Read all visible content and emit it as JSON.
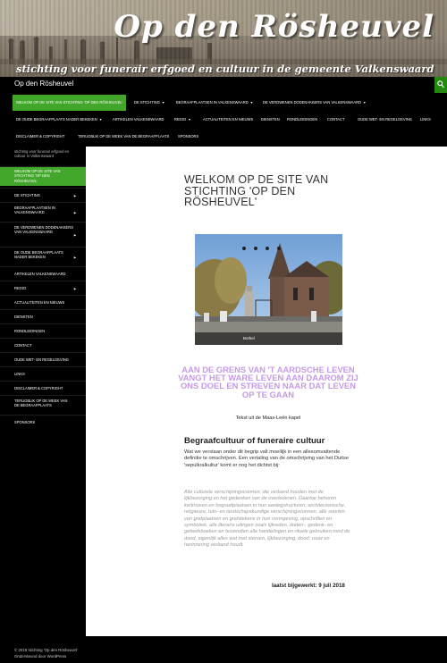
{
  "banner": {
    "title": "Op den Rösheuvel",
    "tagline": "stichting voor funerair erfgoed en cultuur in de gemeente Valkenswaard"
  },
  "topbar": {
    "site_title": "Op den Rösheuvel"
  },
  "nav": {
    "row1": [
      {
        "label": "Welkom op de site van Stichting 'Op den Rösheuvel'",
        "active": true
      },
      {
        "label": "De Stichting",
        "caret": true
      },
      {
        "label": "Begraafplaatsen in Valkenswaard",
        "caret": true
      },
      {
        "label": "De verdwenen dodenakkers van Valkenswaard",
        "caret": true
      }
    ],
    "row2": [
      {
        "label": "De oude begraafplaats nader bekeken",
        "caret": true
      },
      {
        "label": "Artikelen Valkenswaard"
      },
      {
        "label": "Regio",
        "caret": true
      },
      {
        "label": "Actualiteiten en nieuws"
      },
      {
        "label": "Diensten"
      },
      {
        "label": "Rondleidingen"
      },
      {
        "label": "Contact"
      },
      {
        "label": "Oude wet- en regelgeving"
      },
      {
        "label": "Links"
      }
    ],
    "row3": [
      {
        "label": "Disclaimer & copyright"
      },
      {
        "label": "Terugblik op de week van de begraafplaats"
      },
      {
        "label": "Sponsors"
      }
    ],
    "caret_glyph": "▼"
  },
  "sidebar": {
    "description": "stichting voor funerair erfgoed en cultuur in Valkenswaard",
    "items": [
      {
        "label": "Welkom op de site van Stichting 'Op den Rösheuvel'",
        "active": true
      },
      {
        "label": "De Stichting",
        "arrow": true
      },
      {
        "label": "Begraafplaatsen in Valkenswaard",
        "arrow": true
      },
      {
        "label": "De verdwenen dodenakkers van Valkenswaard",
        "arrow": true
      },
      {
        "label": "De oude begraafplaats nader bekeken",
        "arrow": true
      },
      {
        "label": "Artikelen Valkenswaard"
      },
      {
        "label": "Regio",
        "arrow": true
      },
      {
        "label": "Actualiteiten en nieuws"
      },
      {
        "label": "Diensten"
      },
      {
        "label": "Rondleidingen"
      },
      {
        "label": "Contact"
      },
      {
        "label": "Oude wet- en regelgeving"
      },
      {
        "label": "Links"
      },
      {
        "label": "Disclaimer & copyright"
      },
      {
        "label": "Terugblik op de week van de begraafplaats"
      },
      {
        "label": "Sponsors"
      }
    ],
    "arrow_glyph": "►"
  },
  "content": {
    "page_title": "Welkom op de site van Stichting 'Op den Rösheuvel'",
    "slider": {
      "caption": "Borkel",
      "dot_count": 4
    },
    "quote": "Aan de grens van 't aardsche leven vangt het ware leven aan daarom zij ons doel en streven naar dat leven op te gaan",
    "quote_source": "Tekst uit de Maas-Leën kapel",
    "section_title": "Begraafcultuur of funeraire cultuur",
    "paragraph": "Wat we verstaan onder dit begrip valt moeilijk in een allesomvattende definitie te omschrijven. Een vertaling van de omschrijving van het Duitse 'sepulkralkultur' komt er nog het dichtst bij:",
    "italic_paragraph": "Alle culturele verschijningsvormen, die verband houden met de lijkbezorging en het gedenken van de overledenen. Daartoe behoren kerkhoven en begraafplaatsen in hun aanlegstructuren, architectonische, religieuze, tuin- en landschapskundige verschijningsvormen, alle soorten van grafplaatsen en grafstekens in hun vormgeving, opschriften en symboliek, alle literaire uitingen zoals lijkreden, doden-, gedenk- en gebedsboeken en bovendien alle handelingen en rituele gebruiken rond de dood, eigenlijk alles wat met sterven, lijkbezorging, dood, rouw en herinnering verband houdt.",
    "updated": "laatst bijgewerkt: 9 juli 2018"
  },
  "footer": {
    "line1": "© 2018 stichting 'Op den Rösheuvel'",
    "line2": "Ondersteund door WordPress"
  },
  "colors": {
    "accent_green": "#41a62a",
    "quote_purple": "#c59ae6",
    "nav_bg": "#000000"
  },
  "icons": {
    "search": "search-icon"
  }
}
